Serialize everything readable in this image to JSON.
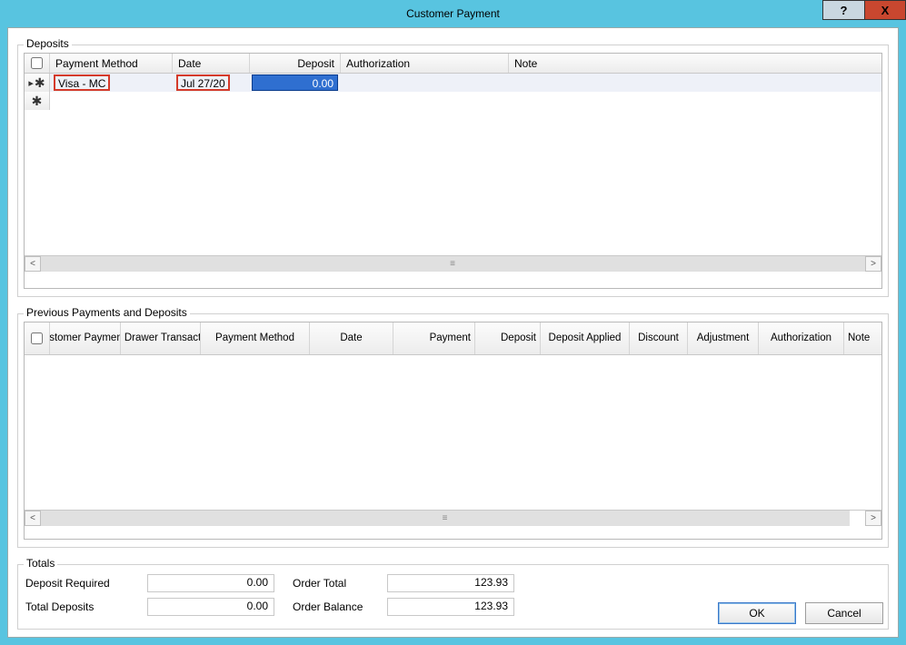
{
  "window": {
    "title": "Customer Payment",
    "help_tooltip": "?",
    "close_label": "X"
  },
  "deposits": {
    "legend": "Deposits",
    "columns": {
      "payment_method": "Payment Method",
      "date": "Date",
      "deposit": "Deposit",
      "authorization": "Authorization",
      "note": "Note"
    },
    "rows": [
      {
        "payment_method": "Visa - MC",
        "date": "Jul 27/20",
        "deposit": "0.00",
        "authorization": "",
        "note": "",
        "highlight_payment_method": true,
        "highlight_date": true,
        "deposit_selected": true,
        "is_current": true,
        "is_new": true
      },
      {
        "payment_method": "",
        "date": "",
        "deposit": "",
        "authorization": "",
        "note": "",
        "is_new": true
      }
    ]
  },
  "previous": {
    "legend": "Previous Payments and Deposits",
    "columns": {
      "customer_payment_no": "Customer Payment #",
      "cash_drawer_txn_no": "Cash Drawer Transaction #",
      "payment_method": "Payment Method",
      "date": "Date",
      "payment": "Payment",
      "deposit": "Deposit",
      "deposit_applied": "Deposit Applied",
      "discount": "Discount",
      "adjustment": "Adjustment",
      "authorization": "Authorization",
      "note": "Note"
    },
    "rows": []
  },
  "totals": {
    "legend": "Totals",
    "deposit_required_label": "Deposit Required",
    "deposit_required": "0.00",
    "total_deposits_label": "Total Deposits",
    "total_deposits": "0.00",
    "order_total_label": "Order Total",
    "order_total": "123.93",
    "order_balance_label": "Order Balance",
    "order_balance": "123.93"
  },
  "buttons": {
    "ok": "OK",
    "cancel": "Cancel"
  }
}
